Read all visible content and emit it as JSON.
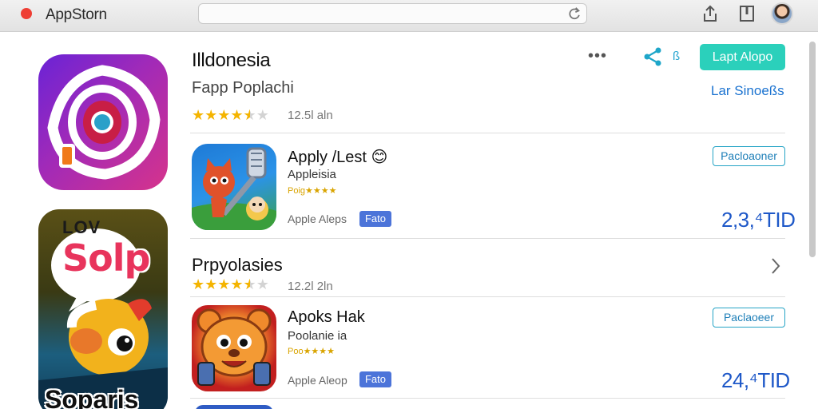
{
  "window": {
    "title": "AppStorn",
    "tab_names": []
  },
  "header": {
    "title": "Illdonesia",
    "subtitle": "Fapp Poplachi",
    "rating": 4.5,
    "rating_text": "12.5l aln",
    "more_label": "•••",
    "share_label": "ß",
    "primary_button": "Lapt Alopo",
    "secondary_link": "Lar Sinoeßs"
  },
  "apps": [
    {
      "name": "Apply /Lest",
      "emoji": "😊",
      "developer": "Appleisia",
      "mini_rating": "Poig★★★★",
      "company": "Apple Aleps",
      "tag": "Fato",
      "button": "Pacloaoner",
      "price": "2,3,⁴TID",
      "icon_name": "game-character-icon"
    },
    {
      "name": "Apoks Hak",
      "emoji": "",
      "developer": "Poolanie ia",
      "mini_rating": "Poo★★★★",
      "company": "Apple Aleop",
      "tag": "Fato",
      "button": "Paclaoeer",
      "price": "24,⁴TID",
      "icon_name": "cartoon-bear-icon"
    }
  ],
  "section": {
    "title": "Prpyolasies",
    "rating": 4.5,
    "rating_text": "12.2l 2ln"
  },
  "featured": {
    "tile1_icon": "eye-target-icon",
    "tile2_top": "LOV",
    "tile2_word": "Solp",
    "tile2_bottom": "Soparis"
  },
  "colors": {
    "accent": "#2bd0bb",
    "link": "#1a72d0",
    "star": "#f4b400",
    "price": "#1e58c8",
    "tag": "#4c74d9"
  }
}
